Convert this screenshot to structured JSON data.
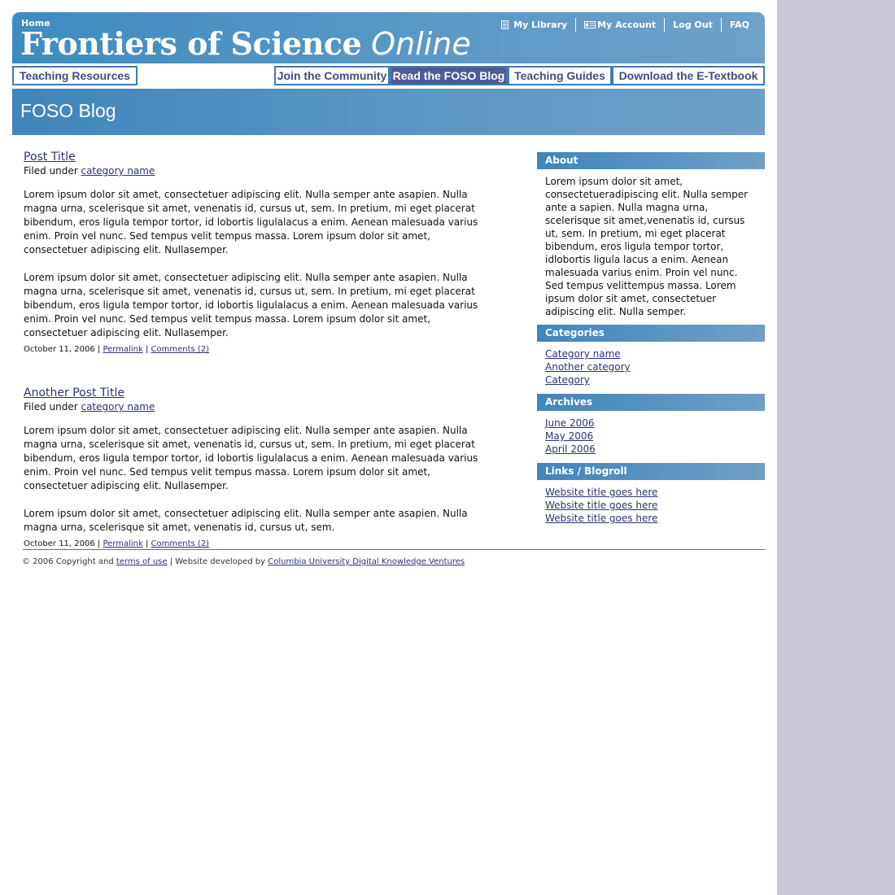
{
  "header": {
    "home": "Home",
    "title_main": "Frontiers of Science",
    "title_italic": "Online",
    "util_nav": [
      {
        "label": "My Library",
        "icon": "book-icon"
      },
      {
        "label": "My Account",
        "icon": "id-card-icon"
      },
      {
        "label": "Log Out"
      },
      {
        "label": "FAQ"
      }
    ]
  },
  "nav": {
    "teaching_resources": "Teaching Resources",
    "tabs": [
      {
        "label": "Join the Community"
      },
      {
        "label": "Read the FOSO Blog",
        "active": true
      },
      {
        "label": "Teaching Guides"
      },
      {
        "label": "Download the E-Textbook"
      }
    ]
  },
  "band": {
    "title": "FOSO Blog"
  },
  "posts": [
    {
      "title": "Post Title",
      "filed_prefix": "Filed under",
      "category": "category name",
      "paragraphs": [
        "Lorem ipsum dolor sit amet, consectetuer adipiscing elit. Nulla semper ante asapien. Nulla magna urna, scelerisque sit amet, venenatis id, cursus ut, sem. In pretium, mi eget placerat bibendum, eros ligula tempor tortor, id lobortis ligulalacus a enim. Aenean malesuada varius enim. Proin vel nunc. Sed tempus velit tempus massa.  Lorem ipsum dolor sit amet, consectetuer adipiscing elit. Nullasemper.",
        "Lorem ipsum dolor sit amet, consectetuer adipiscing elit. Nulla semper ante asapien. Nulla magna urna, scelerisque sit amet, venenatis id, cursus ut, sem. In pretium, mi eget placerat bibendum, eros ligula tempor tortor, id lobortis ligulalacus a enim. Aenean malesuada varius enim. Proin vel nunc. Sed tempus velit tempus massa.  Lorem ipsum dolor sit amet, consectetuer adipiscing elit. Nullasemper."
      ],
      "date": "October 11, 2006",
      "permalink": "Permalink",
      "comments": "Comments (2)"
    },
    {
      "title": "Another Post Title",
      "filed_prefix": "Filed under",
      "category": "category name",
      "paragraphs": [
        "Lorem ipsum dolor sit amet, consectetuer adipiscing elit. Nulla semper ante asapien. Nulla magna urna, scelerisque sit amet, venenatis id, cursus ut, sem. In pretium, mi eget placerat bibendum, eros ligula tempor tortor, id lobortis ligulalacus a enim. Aenean malesuada varius enim. Proin vel nunc. Sed tempus velit tempus massa.  Lorem ipsum dolor sit amet, consectetuer adipiscing elit. Nullasemper.",
        "Lorem ipsum dolor sit amet, consectetuer adipiscing elit. Nulla semper ante asapien. Nulla magna urna, scelerisque sit amet, venenatis id, cursus ut, sem."
      ],
      "date": "October 11, 2006",
      "permalink": "Permalink",
      "comments": "Comments (2)"
    }
  ],
  "sidebar": {
    "about": {
      "title": "About",
      "text": "Lorem ipsum dolor sit amet, consectetueradipiscing elit. Nulla semper ante a sapien. Nulla magna urna, scelerisque sit amet,venenatis id, cursus ut, sem. In pretium, mi eget placerat bibendum, eros ligula tempor tortor, idlobortis ligula lacus a enim. Aenean malesuada varius enim. Proin vel nunc. Sed tempus velittempus massa.  Lorem ipsum dolor sit amet, consectetuer adipiscing elit. Nulla semper."
    },
    "categories": {
      "title": "Categories",
      "items": [
        "Category name",
        "Another category",
        "Category"
      ]
    },
    "archives": {
      "title": "Archives",
      "items": [
        "June 2006",
        "May 2006",
        "April 2006"
      ]
    },
    "links": {
      "title": "Links / Blogroll",
      "items": [
        "Website title goes here",
        "Website title goes here",
        "Website title goes here"
      ]
    }
  },
  "footer": {
    "copyright": "© 2006 Copyright and",
    "terms": "terms of use",
    "developed": "| Website developed by",
    "developer": "Columbia University Digital Knowledge Ventures"
  },
  "colors": {
    "header_blue": "#3d8cc0",
    "link_navy": "#2d3276",
    "active_tab": "#4e5a98",
    "gutter": "#c8c8d6"
  }
}
